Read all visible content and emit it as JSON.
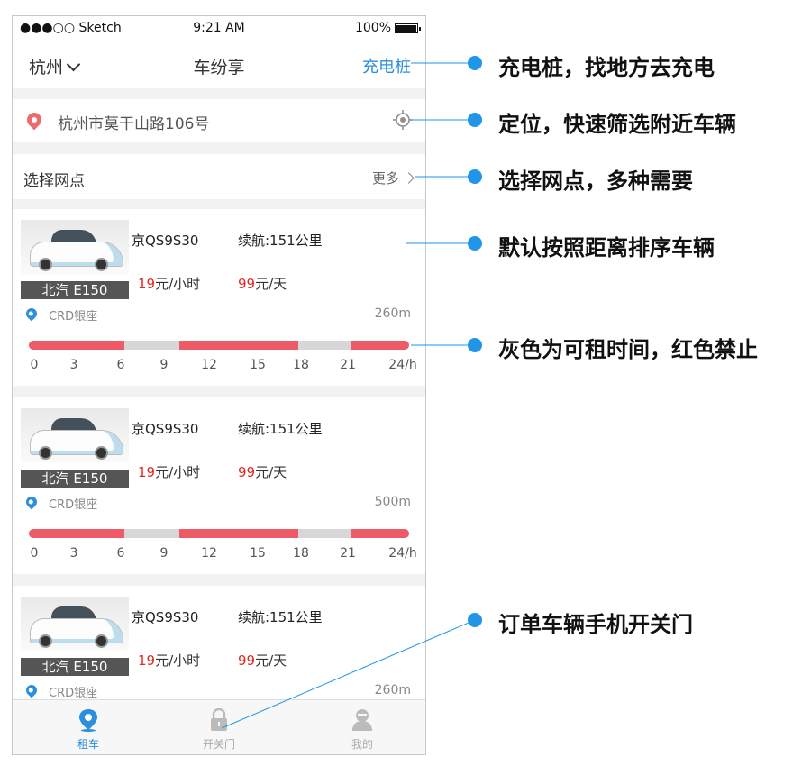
{
  "status_bar": {
    "carrier": "●●●○○ Sketch",
    "time": "9:21 AM",
    "battery": "100%"
  },
  "nav": {
    "city": "杭州",
    "title": "车纷享",
    "charge_link": "充电桩"
  },
  "location": {
    "address": "杭州市莫干山路106号"
  },
  "station": {
    "label": "选择网点",
    "more": "更多"
  },
  "hour_ticks": [
    "0",
    "3",
    "6",
    "9",
    "12",
    "15",
    "18",
    "21",
    "24/h"
  ],
  "availability_legend": {
    "gray": "available",
    "red": "forbidden"
  },
  "availability_blocks": [
    {
      "from": 0,
      "to": 6,
      "status": "red"
    },
    {
      "from": 6,
      "to": 9.5,
      "status": "gray"
    },
    {
      "from": 9.5,
      "to": 17,
      "status": "red"
    },
    {
      "from": 17,
      "to": 20.3,
      "status": "gray"
    },
    {
      "from": 20.3,
      "to": 24,
      "status": "red"
    }
  ],
  "cars": [
    {
      "model": "北汽 E150",
      "plate": "京QS9S30",
      "range": "续航:151公里",
      "hour_price": "19",
      "hour_unit": "元/小时",
      "day_price": "99",
      "day_unit": "元/天",
      "spot": "CRD银座",
      "distance": "260m"
    },
    {
      "model": "北汽 E150",
      "plate": "京QS9S30",
      "range": "续航:151公里",
      "hour_price": "19",
      "hour_unit": "元/小时",
      "day_price": "99",
      "day_unit": "元/天",
      "spot": "CRD银座",
      "distance": "500m"
    },
    {
      "model": "北汽 E150",
      "plate": "京QS9S30",
      "range": "续航:151公里",
      "hour_price": "19",
      "hour_unit": "元/小时",
      "day_price": "99",
      "day_unit": "元/天",
      "spot": "CRD银座",
      "distance": "260m"
    }
  ],
  "tabs": [
    {
      "label": "租车",
      "icon": "map-pin-icon",
      "active": true
    },
    {
      "label": "开关门",
      "icon": "lock-icon",
      "active": false
    },
    {
      "label": "我的",
      "icon": "user-icon",
      "active": false
    }
  ],
  "annotations": [
    "充电桩，找地方去充电",
    "定位，快速筛选附近车辆",
    "选择网点，多种需要",
    "默认按照距离排序车辆",
    "灰色为可租时间，红色禁止",
    "订单车辆手机开关门"
  ],
  "colors": {
    "accent": "#2b8fde",
    "forbidden": "#ef5a67",
    "available": "#d7d7d7",
    "price": "#e3281e",
    "annotation_dot": "#2196e8"
  }
}
